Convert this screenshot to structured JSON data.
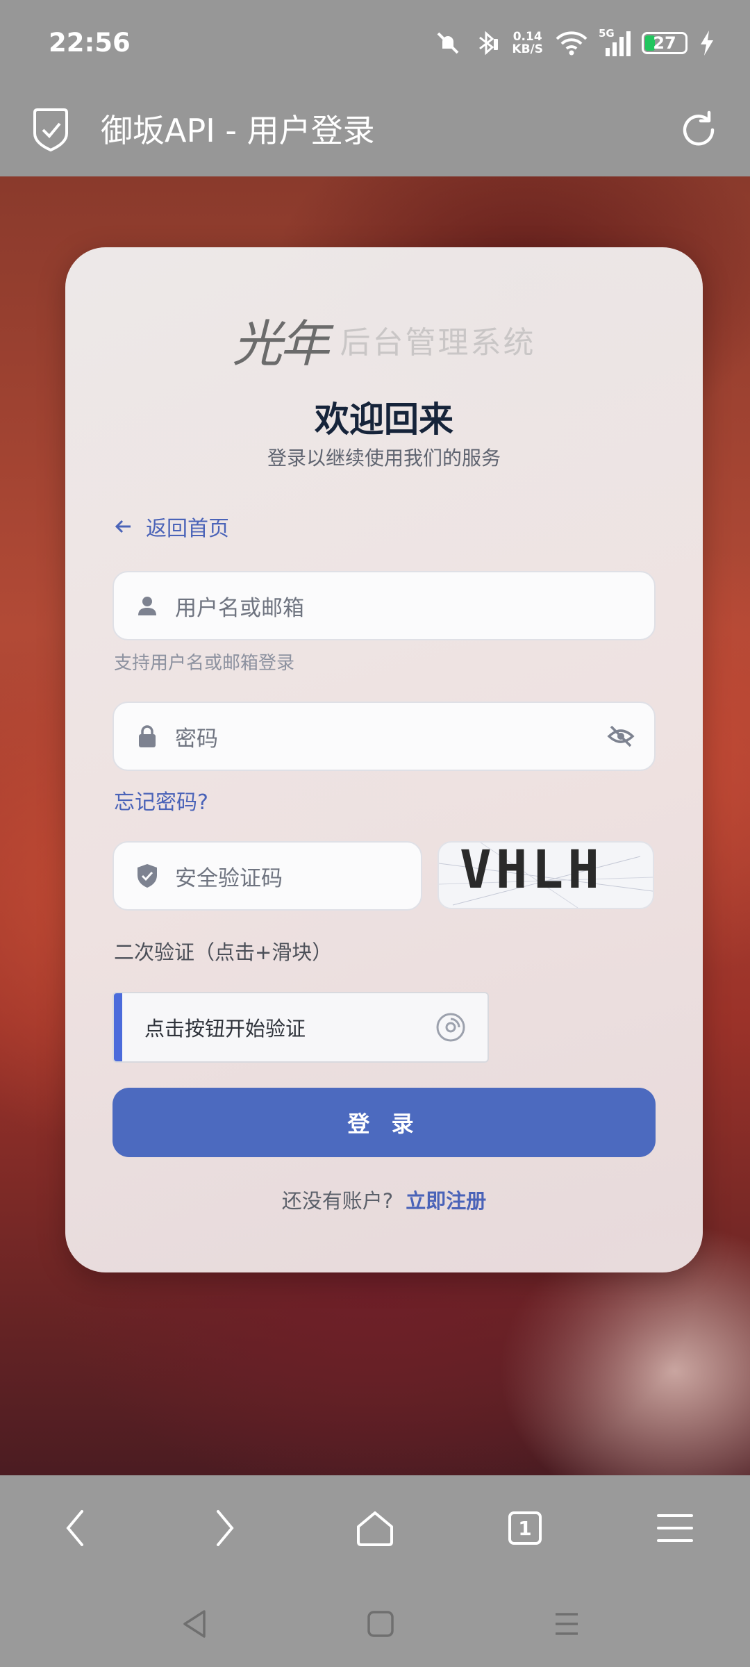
{
  "status_bar": {
    "time": "22:56",
    "net_speed_value": "0.14",
    "net_speed_unit": "KB/S",
    "signal_label": "5G",
    "battery": "27"
  },
  "browser": {
    "title": "御坂API - 用户登录"
  },
  "login": {
    "logo_script": "光年",
    "logo_text": "后台管理系统",
    "welcome": "欢迎回来",
    "subtitle": "登录以继续使用我们的服务",
    "back_home": "返回首页",
    "username_placeholder": "用户名或邮箱",
    "username_hint": "支持用户名或邮箱登录",
    "password_placeholder": "密码",
    "forgot_password": "忘记密码?",
    "captcha_placeholder": "安全验证码",
    "captcha_text": "VHLH",
    "second_verify_title": "二次验证（点击+滑块）",
    "second_verify_button": "点击按钮开始验证",
    "login_button": "登 录",
    "no_account": "还没有账户?",
    "register_link": "立即注册"
  },
  "nav": {
    "tab_count": "1"
  },
  "colors": {
    "accent": "#4c6abf",
    "link": "#4a63b8",
    "verify_bar": "#4b6bdb",
    "battery_fill": "#22c55e"
  }
}
